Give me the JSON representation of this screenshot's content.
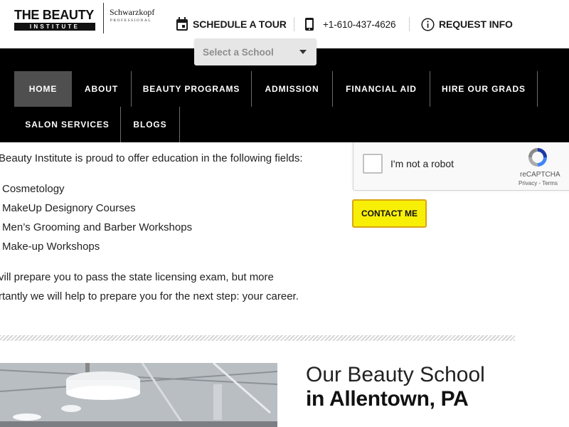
{
  "header": {
    "logo_line1": "THE BEAUTY",
    "logo_line2": "INSTITUTE",
    "partner_name": "Schwarzkopf",
    "partner_sub": "PROFESSIONAL",
    "schedule_tour": "SCHEDULE A TOUR",
    "phone": "+1-610-437-4626",
    "request_info": "REQUEST INFO",
    "icons": {
      "tour": "calendar-icon",
      "phone": "phone-icon",
      "info": "info-icon"
    }
  },
  "school_select": {
    "placeholder": "Select a School"
  },
  "nav": {
    "items": [
      {
        "label": "HOME",
        "active": true
      },
      {
        "label": "ABOUT"
      },
      {
        "label": "BEAUTY PROGRAMS"
      },
      {
        "label": "ADMISSION"
      },
      {
        "label": "FINANCIAL AID"
      },
      {
        "label": "HIRE OUR GRADS"
      },
      {
        "label": "SALON SERVICES"
      },
      {
        "label": "BLOGS"
      }
    ]
  },
  "content": {
    "intro": "Beauty Institute is proud to offer education in the following fields:",
    "programs": [
      "Cosmetology",
      "MakeUp Designory Courses",
      "Men’s Grooming and Barber Workshops",
      "Make-up Workshops"
    ],
    "closing_line1": "vill prepare you to pass the state licensing exam, but more",
    "closing_line2": "rtantly we will help to prepare you for the next step: your career."
  },
  "recaptcha": {
    "label": "I'm not a robot",
    "brand": "reCAPTCHA",
    "links": "Privacy - Terms"
  },
  "contact_button": "CONTACT ME",
  "location": {
    "title_line1": "Our Beauty School",
    "title_line2": "in Allentown, PA"
  },
  "colors": {
    "nav_background": "#000000",
    "nav_active": "#4f4f4f",
    "button_yellow": "#f8ef07",
    "button_border": "#d9a413"
  }
}
